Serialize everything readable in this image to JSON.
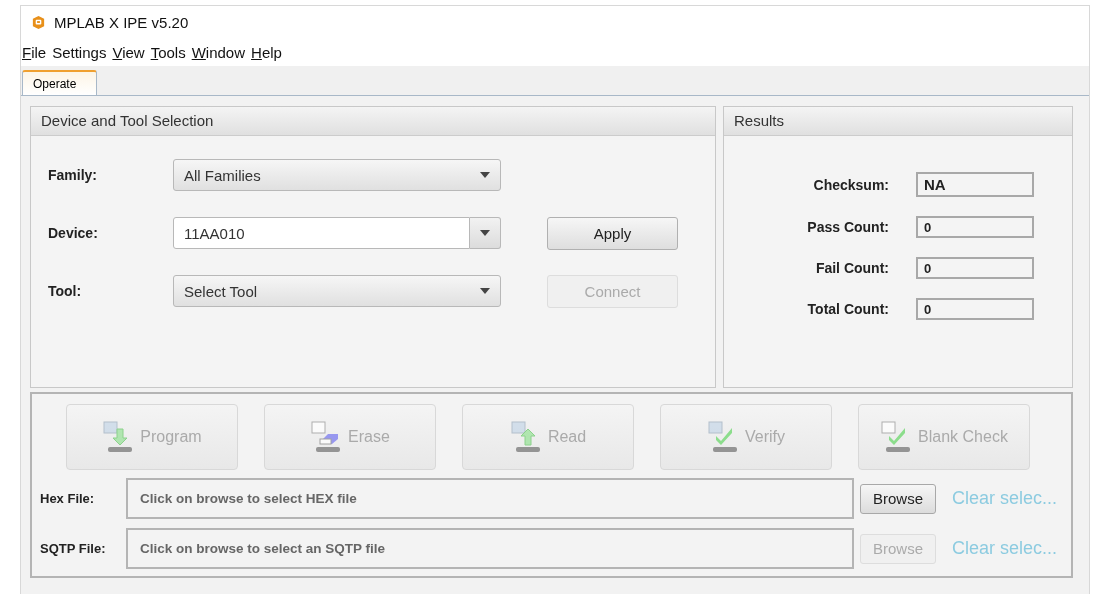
{
  "window": {
    "title": "MPLAB X IPE v5.20"
  },
  "menu": [
    {
      "label": "File",
      "mnemonic": true
    },
    {
      "label": "Settings",
      "mnemonic": false
    },
    {
      "label": "View",
      "mnemonic": true
    },
    {
      "label": "Tools",
      "mnemonic": true
    },
    {
      "label": "Window",
      "mnemonic": true
    },
    {
      "label": "Help",
      "mnemonic": true
    }
  ],
  "tabs": [
    {
      "label": "Operate",
      "selected": true
    }
  ],
  "device_panel": {
    "title": "Device and Tool Selection",
    "rows": [
      {
        "label": "Family:",
        "kind": "combo",
        "value": "All Families"
      },
      {
        "label": "Device:",
        "kind": "editable",
        "value": "11AA010",
        "button": {
          "label": "Apply",
          "disabled": false
        }
      },
      {
        "label": "Tool:",
        "kind": "combo",
        "value": "Select Tool",
        "button": {
          "label": "Connect",
          "disabled": true
        }
      }
    ]
  },
  "results": {
    "title": "Results",
    "fields": [
      {
        "label": "Checksum:",
        "value": "NA"
      },
      {
        "label": "Pass Count:",
        "value": "0"
      },
      {
        "label": "Fail Count:",
        "value": "0"
      },
      {
        "label": "Total Count:",
        "value": "0"
      }
    ]
  },
  "actions": [
    {
      "label": "Program",
      "kind": "program",
      "disabled": true
    },
    {
      "label": "Erase",
      "kind": "erase",
      "disabled": true
    },
    {
      "label": "Read",
      "kind": "read",
      "disabled": true
    },
    {
      "label": "Verify",
      "kind": "verify",
      "disabled": true
    },
    {
      "label": "Blank Check",
      "kind": "blank",
      "disabled": true
    }
  ],
  "files": [
    {
      "label": "Hex File:",
      "placeholder": "Click on browse to select HEX file",
      "browse": {
        "label": "Browse",
        "disabled": false
      },
      "clear": "Clear selec..."
    },
    {
      "label": "SQTP File:",
      "placeholder": "Click on browse to select an SQTP file",
      "browse": {
        "label": "Browse",
        "disabled": true
      },
      "clear": "Clear selec..."
    }
  ]
}
